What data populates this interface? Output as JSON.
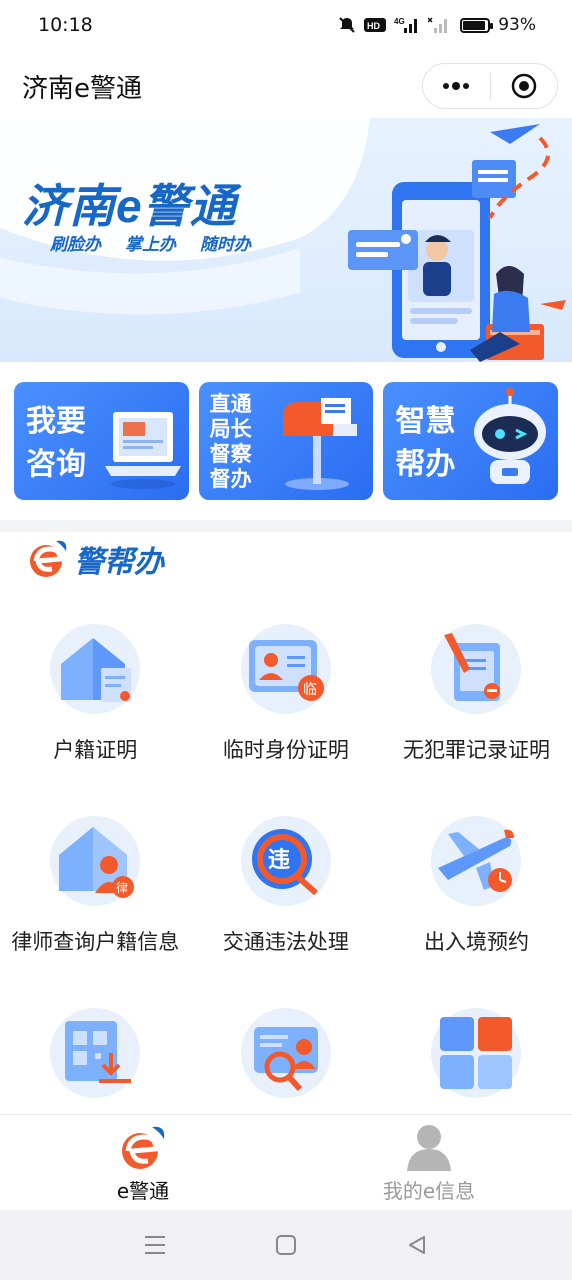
{
  "status": {
    "time": "10:18",
    "battery": "93%",
    "battery_level": 0.93,
    "icons": [
      "mute-icon",
      "hd-icon",
      "4g-signal-icon",
      "no-sim-signal-icon",
      "battery-icon"
    ]
  },
  "header": {
    "title": "济南e警通",
    "menu_icon": "more-dots-icon",
    "close_icon": "target-circle-icon"
  },
  "banner": {
    "brand": "济南e警通",
    "slogans": [
      "刷脸办",
      "掌上办",
      "随时办"
    ]
  },
  "quick_cards": [
    {
      "lines": [
        "我要",
        "咨询"
      ],
      "icon": "laptop-icon"
    },
    {
      "lines": [
        "直通",
        "局长",
        "督察",
        "督办"
      ],
      "icon": "mailbox-icon"
    },
    {
      "lines": [
        "智慧",
        "帮办"
      ],
      "icon": "robot-icon"
    }
  ],
  "section": {
    "title": "警帮办",
    "logo_icon": "e-logo-icon"
  },
  "services": [
    {
      "label": "户籍证明",
      "icon": "house-document-icon"
    },
    {
      "label": "临时身份证明",
      "icon": "id-card-temp-icon"
    },
    {
      "label": "无犯罪记录证明",
      "icon": "document-pen-icon"
    },
    {
      "label": "律师查询户籍信息",
      "icon": "house-lawyer-icon"
    },
    {
      "label": "交通违法处理",
      "icon": "traffic-violation-icon"
    },
    {
      "label": "出入境预约",
      "icon": "airplane-clock-icon"
    },
    {
      "label": "",
      "icon": "qr-download-icon"
    },
    {
      "label": "",
      "icon": "id-search-icon"
    },
    {
      "label": "",
      "icon": "grid-apps-icon"
    }
  ],
  "tabs": [
    {
      "label": "e警通",
      "icon": "e-logo-icon",
      "active": true
    },
    {
      "label": "我的e信息",
      "icon": "user-icon",
      "active": false
    }
  ],
  "colors": {
    "primary": "#2a6df2",
    "brand_blue": "#1767c9",
    "accent_orange": "#f25a2b",
    "inactive": "#9a9a9a"
  }
}
